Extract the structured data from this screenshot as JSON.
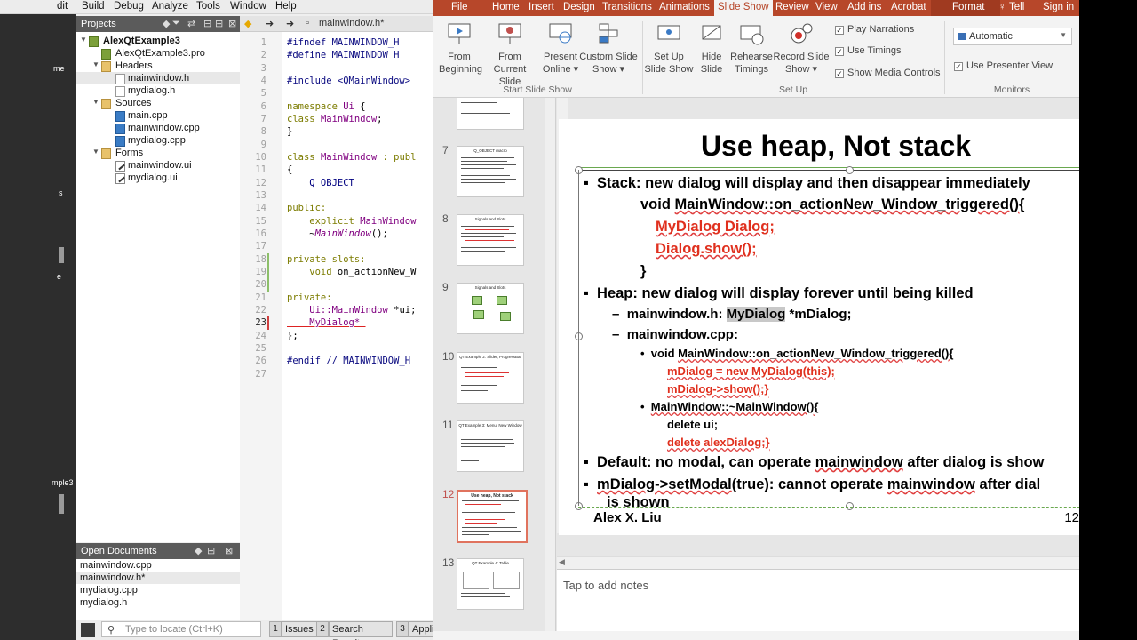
{
  "qt": {
    "menu": [
      "dit",
      "Build",
      "Debug",
      "Analyze",
      "Tools",
      "Window",
      "Help"
    ],
    "modebar_labels": [
      "me",
      "s",
      "e",
      "mple3"
    ],
    "projects_header": "Projects",
    "tree": {
      "project": "AlexQtExample3",
      "pro_file": "AlexQtExample3.pro",
      "headers": "Headers",
      "h1": "mainwindow.h",
      "h2": "mydialog.h",
      "sources": "Sources",
      "s1": "main.cpp",
      "s2": "mainwindow.cpp",
      "s3": "mydialog.cpp",
      "forms": "Forms",
      "f1": "mainwindow.ui",
      "f2": "mydialog.ui"
    },
    "open_documents_header": "Open Documents",
    "open_documents": [
      "mainwindow.cpp",
      "mainwindow.h*",
      "mydialog.cpp",
      "mydialog.h"
    ],
    "editor_file": "mainwindow.h*",
    "line_numbers": [
      "1",
      "2",
      "3",
      "4",
      "5",
      "6",
      "7",
      "8",
      "9",
      "10",
      "11",
      "12",
      "13",
      "14",
      "15",
      "16",
      "17",
      "18",
      "19",
      "20",
      "21",
      "22",
      "23",
      "24",
      "25",
      "26",
      "27"
    ],
    "code": {
      "l1": "#ifndef MAINWINDOW_H",
      "l2": "#define MAINWINDOW_H",
      "l4": "#include <QMainWindow>",
      "l6a": "namespace ",
      "l6b": "Ui",
      "l6c": " {",
      "l7a": "class ",
      "l7b": "MainWindow",
      "l7c": ";",
      "l8": "}",
      "l10a": "class ",
      "l10b": "MainWindow",
      "l10c": " : publ",
      "l11": "{",
      "l12": "    Q_OBJECT",
      "l14": "public:",
      "l15a": "    explicit ",
      "l15b": "MainWindow",
      "l16a": "    ~",
      "l16b": "MainWindow",
      "l16c": "();",
      "l18": "private slots:",
      "l19a": "    void ",
      "l19b": "on_actionNew_W",
      "l21": "private:",
      "l22a": "    Ui::",
      "l22b": "MainWindow",
      "l22c": " *ui;",
      "l23": "    MyDialog* ",
      "l25": "};",
      "l27": "#endif // MAINWINDOW_H"
    },
    "locate_placeholder": "Type to locate (Ctrl+K)",
    "output_tabs": [
      {
        "num": "1",
        "label": "Issues"
      },
      {
        "num": "2",
        "label": "Search Results"
      },
      {
        "num": "3",
        "label": "Applic"
      }
    ]
  },
  "ppt": {
    "tabs": [
      "File",
      "Home",
      "Insert",
      "Design",
      "Transitions",
      "Animations",
      "Slide Show",
      "Review",
      "View",
      "Add ins",
      "Acrobat",
      "Format",
      "Tell",
      "Sign in"
    ],
    "active_tab": "Slide Show",
    "ribbon": {
      "from_beginning": [
        "From",
        "Beginning"
      ],
      "from_current": [
        "From",
        "Current Slide"
      ],
      "present_online": [
        "Present",
        "Online ▾"
      ],
      "custom_show": [
        "Custom Slide",
        "Show ▾"
      ],
      "group_start": "Start Slide Show",
      "setup_show": [
        "Set Up",
        "Slide Show"
      ],
      "hide_slide": [
        "Hide",
        "Slide"
      ],
      "rehearse": [
        "Rehearse",
        "Timings"
      ],
      "record": [
        "Record Slide",
        "Show ▾"
      ],
      "play_narrations": "Play Narrations",
      "use_timings": "Use Timings",
      "show_media_controls": "Show Media Controls",
      "group_setup": "Set Up",
      "monitor": "Automatic",
      "use_presenter_view": "Use Presenter View",
      "group_monitors": "Monitors"
    },
    "slide_numbers": [
      "7",
      "8",
      "9",
      "10",
      "11",
      "12",
      "13"
    ],
    "thumb_titles": [
      "Q_OBJECT macro",
      "Signals and Slots",
      "Signals and Slots",
      "QT Example 2: Slider, ProgressBar",
      "QT Example 3: Menu, New Window",
      "Use heap, Not stack",
      "QT Example 4: Table"
    ],
    "slide": {
      "title": "Use heap, Not stack",
      "b1": "Stack: new dialog will display and then disappear immediately",
      "b1_code1a": "void ",
      "b1_code1b": "MainWindow::on_actionNew_Window_triggered(){",
      "b1_code2": "MyDialog Dialog;",
      "b1_code3": "Dialog.show();",
      "b1_code4": "}",
      "b2": "Heap: new dialog will display forever until being killed",
      "b2_s1a": "mainwindow.h: ",
      "b2_s1b": "MyDialog",
      "b2_s1c": " *mDialog;",
      "b2_s2": "mainwindow.cpp:",
      "b2_s3a": "void ",
      "b2_s3b": "MainWindow::on_actionNew_Window_triggered(){",
      "b2_s4": "mDialog = new MyDialog(this);",
      "b2_s5": "mDialog->show();}",
      "b2_s6": "MainWindow::~MainWindow(){",
      "b2_s7": "delete ui;",
      "b2_s8": "delete alexDialog;}",
      "b3a": "Default: no modal, can operate ",
      "b3b": "mainwindow",
      "b3c": " after dialog is show",
      "b4a": "mDialog->setModal",
      "b4b": "(true): cannot operate ",
      "b4c": "mainwindow",
      "b4d": " after dial",
      "b4e": "is shown",
      "footer": "Alex X. Liu",
      "page": "12"
    },
    "notes_placeholder": "Tap to add notes"
  }
}
